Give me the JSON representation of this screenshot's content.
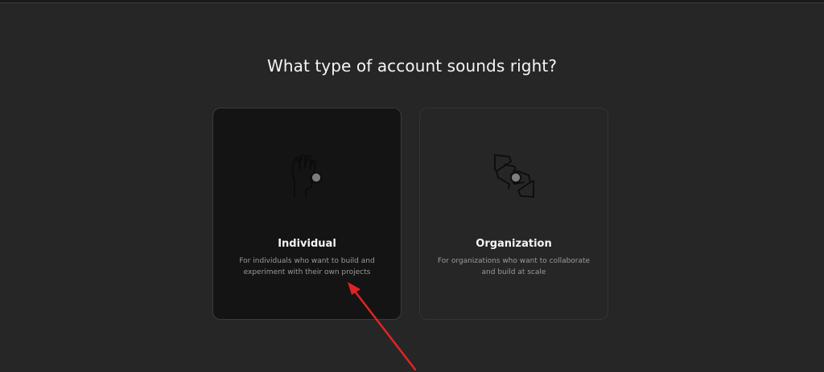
{
  "page": {
    "title": "What type of account sounds right?"
  },
  "options": [
    {
      "id": "individual",
      "icon": "ok-hand-icon",
      "label": "Individual",
      "description_line1": "For individuals who want to build and",
      "description_line2": "experiment with their own projects",
      "selected": true
    },
    {
      "id": "organization",
      "icon": "handshake-icon",
      "label": "Organization",
      "description_line1": "For organizations who want to collaborate",
      "description_line2": "and build at scale",
      "selected": false
    }
  ],
  "colors": {
    "background": "#262626",
    "selected_card": "#141414",
    "annotation_arrow": "#e02424"
  }
}
